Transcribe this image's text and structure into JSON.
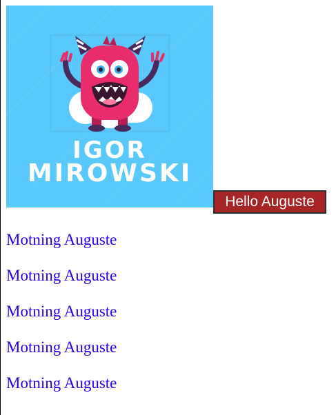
{
  "logo": {
    "first_name": "IGOR",
    "last_name": "MIROWSKI",
    "image": "monster-mascot"
  },
  "hello_button": {
    "label": "Hello Auguste"
  },
  "greetings": [
    {
      "label": "Motning Auguste"
    },
    {
      "label": "Motning Auguste"
    },
    {
      "label": "Motning Auguste"
    },
    {
      "label": "Motning Auguste"
    },
    {
      "label": "Motning Auguste"
    }
  ],
  "colors": {
    "logo_background": "#59c9fb",
    "monster_body": "#e92c6b",
    "button_background": "#a82525",
    "link": "#2200ee"
  }
}
